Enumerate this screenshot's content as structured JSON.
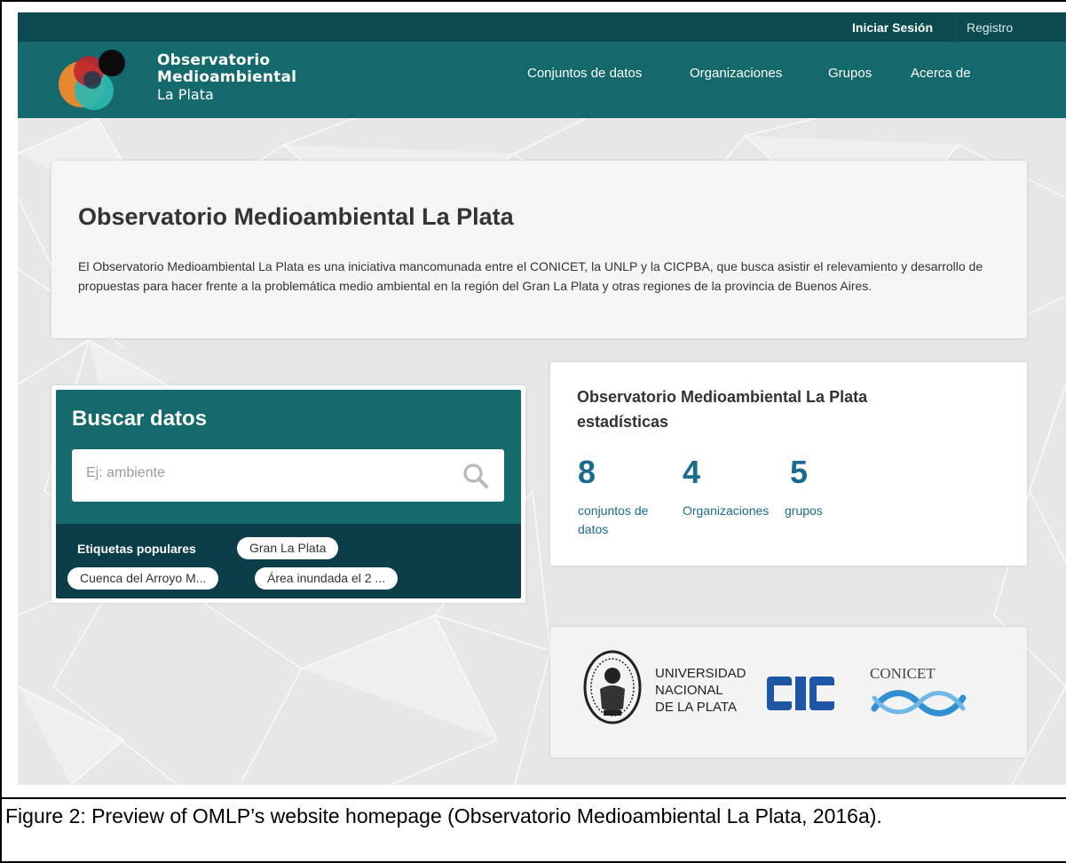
{
  "header": {
    "login_label": "Iniciar Sesión",
    "register_label": "Registro"
  },
  "brand": {
    "line1": "Observatorio",
    "line2": "Medioambiental",
    "line3": "La Plata"
  },
  "nav": {
    "items": [
      {
        "label": "Conjuntos de datos"
      },
      {
        "label": "Organizaciones"
      },
      {
        "label": "Grupos"
      },
      {
        "label": "Acerca de"
      }
    ]
  },
  "intro": {
    "title": "Observatorio Medioambiental La Plata",
    "description": "El Observatorio Medioambiental La Plata es una iniciativa mancomunada entre el CONICET, la UNLP y la CICPBA, que busca asistir el relevamiento y desarrollo de propuestas para hacer frente a la problemática medio ambiental en la región del Gran La Plata y otras regiones de la provincia de Buenos Aires."
  },
  "search": {
    "title": "Buscar datos",
    "placeholder": "Ej: ambiente",
    "tags_label": "Etiquetas populares",
    "tags": [
      "Gran La Plata",
      "Cuenca del Arroyo M...",
      "Área inundada el 2 ..."
    ]
  },
  "stats": {
    "title_line1": "Observatorio Medioambiental La Plata",
    "title_line2": "estadísticas",
    "items": [
      {
        "value": "8",
        "label_line1": "conjuntos de",
        "label_line2": "datos"
      },
      {
        "value": "4",
        "label_line1": "Organizaciones",
        "label_line2": ""
      },
      {
        "value": "5",
        "label_line1": "grupos",
        "label_line2": ""
      }
    ]
  },
  "partners": {
    "unlp_line1": "UNIVERSIDAD",
    "unlp_line2": "NACIONAL",
    "unlp_line3": "DE LA PLATA",
    "cic_logo_text": "CIC",
    "conicet_text": "CONICET"
  },
  "caption": "Figure 2: Preview of OMLP’s website homepage (Observatorio Medioambiental La Plata, 2016a).",
  "colors": {
    "topbar": "#0b4a4e",
    "nav": "#13696b",
    "tags_bg": "#0b3e48",
    "stat_blue": "#1a6b8e"
  }
}
